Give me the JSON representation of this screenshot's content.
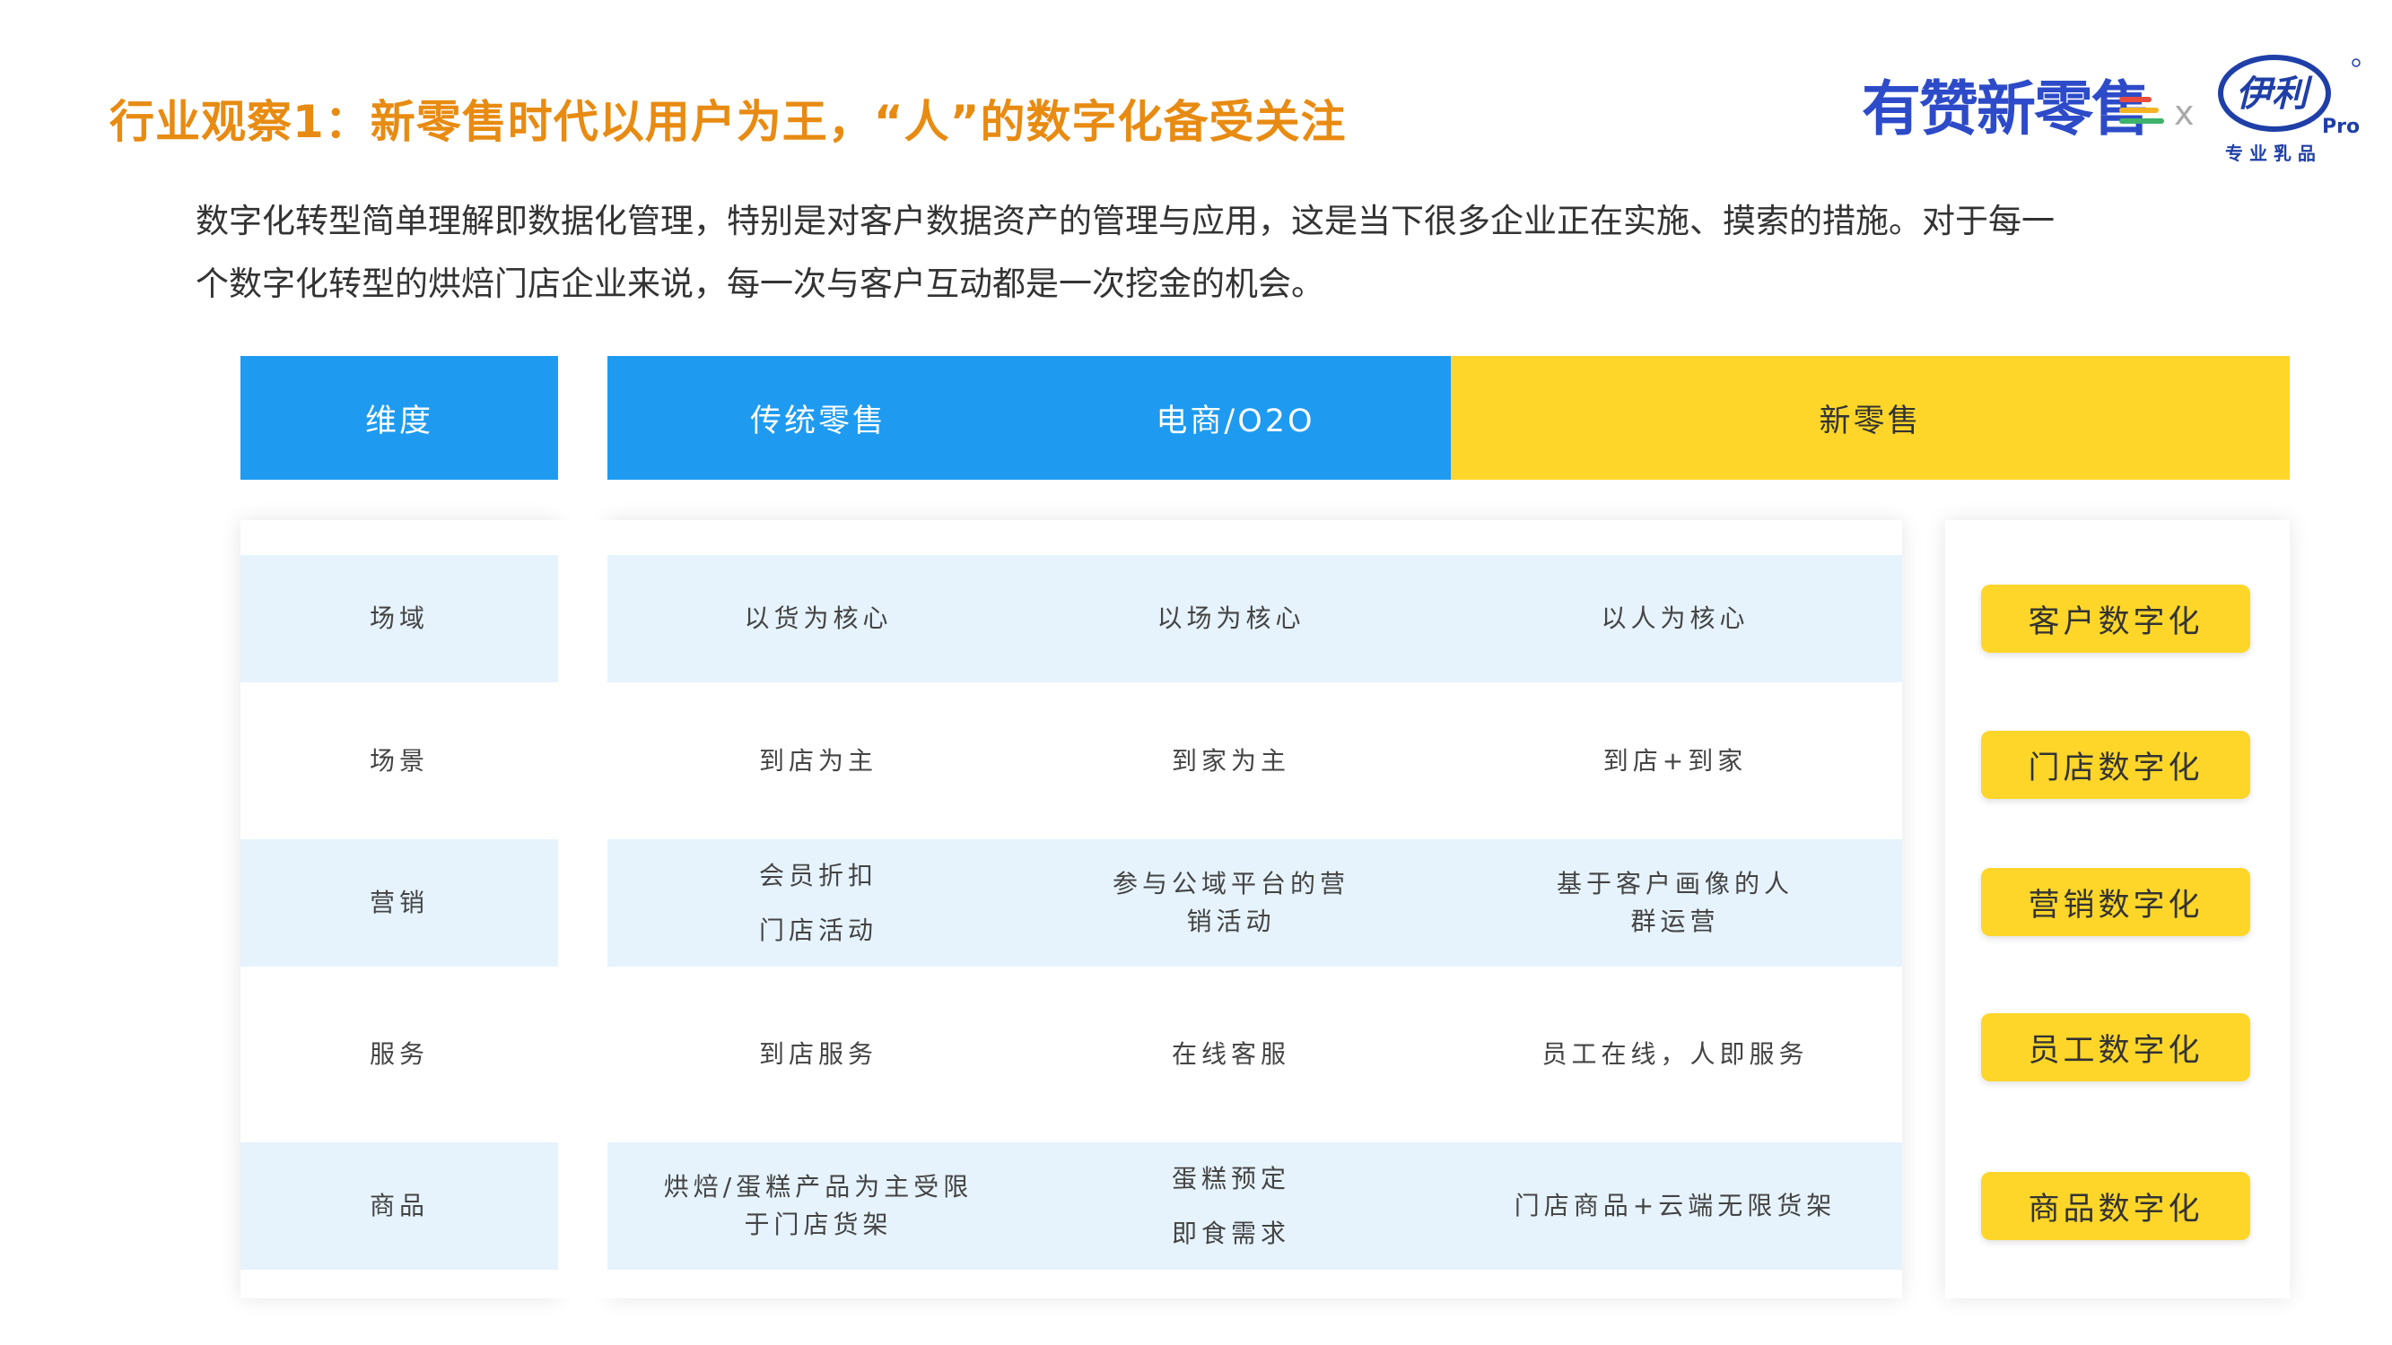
{
  "title": "行业观察1：新零售时代以用户为王，“人”的数字化备受关注",
  "intro": {
    "line1": "数字化转型简单理解即数据化管理，特别是对客户数据资产的管理与应用，这是当下很多企业正在实施、摸索的措施。对于每一",
    "line2": "个数字化转型的烘焙门店企业来说，每一次与客户互动都是一次挖金的机会。"
  },
  "logos": {
    "youzan": "有赞新零售",
    "separator": "x",
    "yili_brand": "伊利",
    "yili_pro": "Pro",
    "yili_tagline": "专 业 乳 品",
    "stripe_colors": [
      "#E94B3C",
      "#F5B324",
      "#3DB36B"
    ]
  },
  "table": {
    "headers": {
      "dimension": "维度",
      "traditional": "传统零售",
      "ecommerce": "电商/O2O",
      "new_retail": "新零售"
    },
    "rows": [
      {
        "dimension": "场域",
        "traditional": [
          "以货为核心"
        ],
        "ecommerce": [
          "以场为核心"
        ],
        "new_retail": [
          "以人为核心"
        ],
        "badge": "客户数字化"
      },
      {
        "dimension": "场景",
        "traditional": [
          "到店为主"
        ],
        "ecommerce": [
          "到家为主"
        ],
        "new_retail": [
          "到店+到家"
        ],
        "badge": "门店数字化"
      },
      {
        "dimension": "营销",
        "traditional": [
          "会员折扣",
          "门店活动"
        ],
        "ecommerce": [
          "参与公域平台的营",
          "销活动"
        ],
        "new_retail": [
          "基于客户画像的人",
          "群运营"
        ],
        "badge": "营销数字化"
      },
      {
        "dimension": "服务",
        "traditional": [
          "到店服务"
        ],
        "ecommerce": [
          "在线客服"
        ],
        "new_retail": [
          "员工在线，人即服务"
        ],
        "badge": "员工数字化"
      },
      {
        "dimension": "商品",
        "traditional": [
          "烘焙/蛋糕产品为主受限",
          "于门店货架"
        ],
        "ecommerce": [
          "蛋糕预定",
          "即食需求"
        ],
        "new_retail": [
          "门店商品+云端无限货架"
        ],
        "badge": "商品数字化"
      }
    ]
  },
  "colors": {
    "title": "#E88B12",
    "header_blue": "#1E9BF0",
    "header_yellow": "#FDD629",
    "row_shade": "#E6F3FD",
    "badge": "#FDD629"
  }
}
